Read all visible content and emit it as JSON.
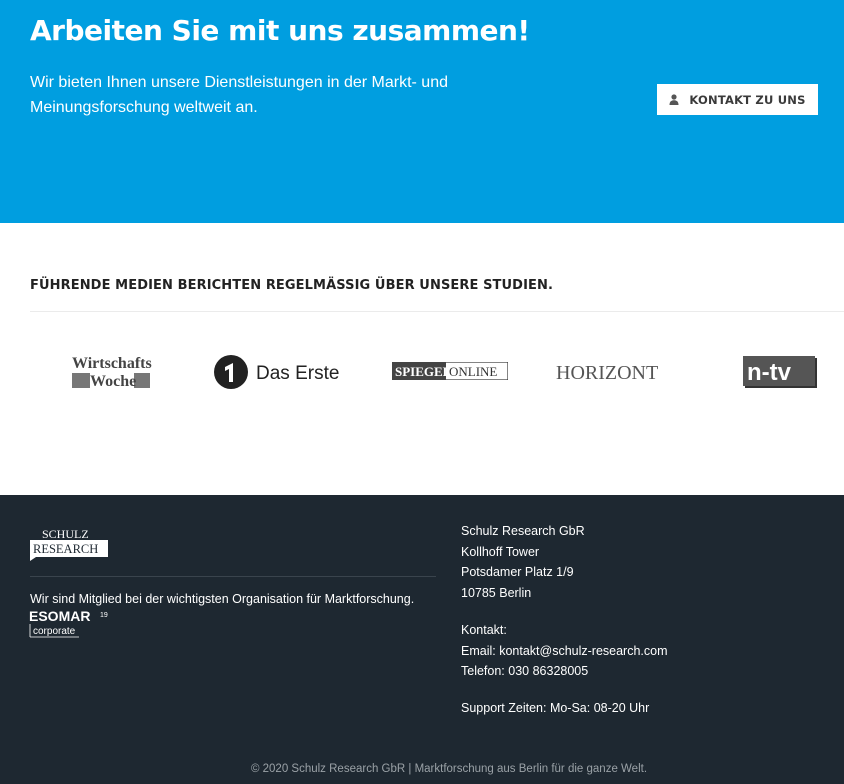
{
  "hero": {
    "title": "Arbeiten Sie mit uns zusammen!",
    "text": "Wir bieten Ihnen unsere Dienstleistungen in der Markt- und Meinungsforschung weltweit an.",
    "contact_button": "KONTAKT ZU UNS",
    "contact_icon": "user-icon",
    "background_color": "#009ee0"
  },
  "media": {
    "heading": "FÜHRENDE MEDIEN BERICHTEN REGELMÄSSIG ÜBER UNSERE STUDIEN.",
    "logos": [
      {
        "name": "wirtschaftswoche-logo",
        "text_line1": "Wirtschafts",
        "text_line2": "Woche"
      },
      {
        "name": "das-erste-logo",
        "text": "Das Erste"
      },
      {
        "name": "spiegel-online-logo",
        "text_left": "SPIEGEL",
        "text_right": "ONLINE"
      },
      {
        "name": "horizont-logo",
        "text": "HORIZONT"
      },
      {
        "name": "ntv-logo",
        "text": "n-tv"
      }
    ]
  },
  "footer": {
    "background_color": "#1e2831",
    "logo_line1": "SCHULZ",
    "logo_line2": "RESEARCH",
    "member_text": "Wir sind Mitglied bei der wichtigsten Organisation für Marktforschung.",
    "esomar_main": "ESOMAR",
    "esomar_sup": "19",
    "esomar_sub": "corporate",
    "address": {
      "company": "Schulz Research GbR",
      "building": "Kollhoff Tower",
      "street": "Potsdamer Platz 1/9",
      "city": "10785 Berlin"
    },
    "contact": {
      "label": "Kontakt:",
      "email": "Email: kontakt@schulz-research.com",
      "phone": "Telefon: 030 86328005"
    },
    "support": "Support Zeiten: Mo-Sa: 08-20 Uhr",
    "copyright": "© 2020 Schulz Research GbR | Marktforschung aus Berlin für die ganze Welt."
  }
}
